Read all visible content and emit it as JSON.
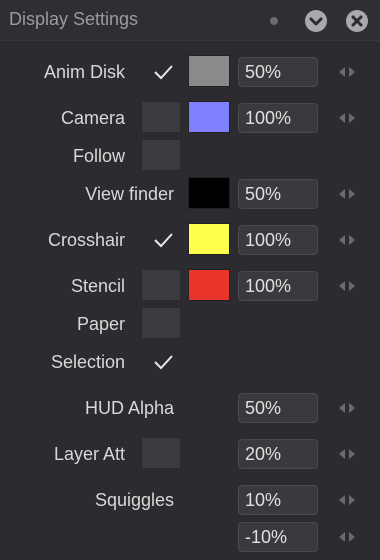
{
  "panel": {
    "title": "Display Settings",
    "icons": [
      "dot-icon",
      "menu-chevron-icon",
      "close-icon"
    ]
  },
  "rows": [
    {
      "label": "Anim Disk",
      "checked": true,
      "color": "#8a8a8a",
      "value": "50%"
    },
    {
      "label": "Camera",
      "checked": false,
      "color": "#7f80ff",
      "value": "100%"
    },
    {
      "label": "Follow",
      "checked": false
    },
    {
      "label": "View finder",
      "color": "#000000",
      "value": "50%"
    },
    {
      "label": "Crosshair",
      "checked": true,
      "color": "#ffff4d",
      "value": "100%"
    },
    {
      "label": "Stencil",
      "checked": false,
      "color": "#e8342a",
      "value": "100%"
    },
    {
      "label": "Paper",
      "checked": false
    },
    {
      "label": "Selection",
      "checked": true
    },
    {
      "label": "HUD Alpha",
      "value": "50%"
    },
    {
      "label": "Layer Att",
      "checked": false,
      "value": "20%"
    },
    {
      "label": "Squiggles",
      "value": "10%"
    },
    {
      "value": "-10%"
    }
  ]
}
